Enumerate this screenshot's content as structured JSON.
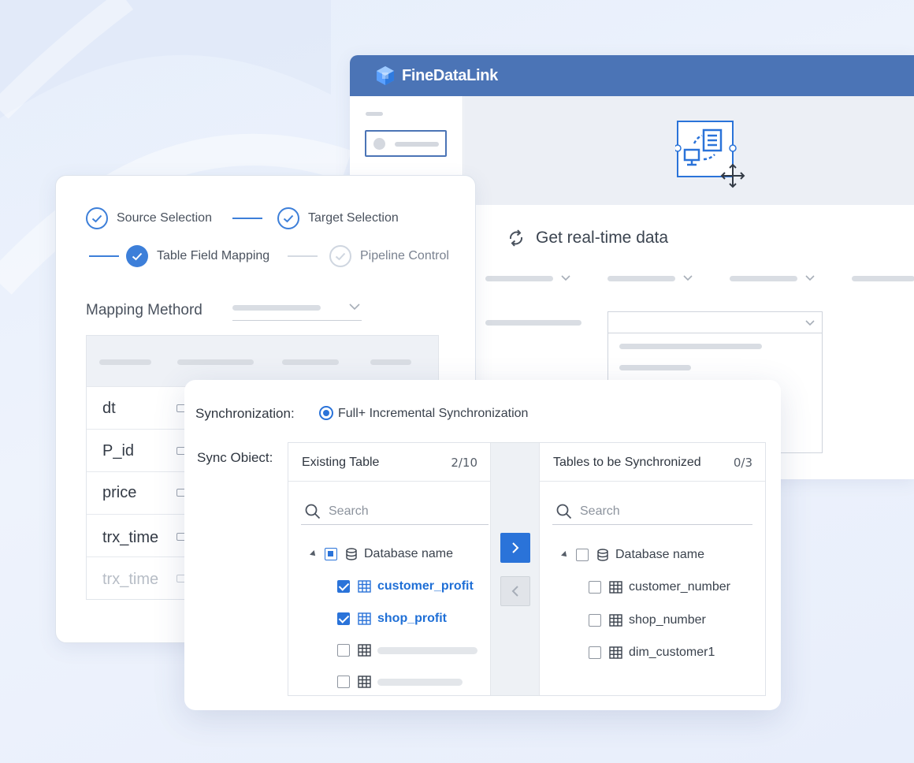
{
  "app": {
    "brand": "FineDataLink",
    "realtime_title": "Get real-time data"
  },
  "steps": [
    {
      "label": "Source Selection",
      "state": "done"
    },
    {
      "label": "Target Selection",
      "state": "done"
    },
    {
      "label": "Table Field Mapping",
      "state": "current"
    },
    {
      "label": "Pipeline Control",
      "state": "pending"
    }
  ],
  "mapping": {
    "label": "Mapping Methord",
    "rows": [
      "dt",
      "P_id",
      "price",
      "trx_time",
      "trx_time"
    ]
  },
  "sync": {
    "sync_label": "Synchronization:",
    "sync_option": "Full+ Incremental Synchronization",
    "object_label": "Sync Obiect:",
    "left": {
      "title": "Existing Table",
      "count": "2/10",
      "search_placeholder": "Search",
      "database": "Database name",
      "tables": [
        "customer_profit",
        "shop_profit"
      ]
    },
    "right": {
      "title": "Tables to be Synchronized",
      "count": "0/3",
      "search_placeholder": "Search",
      "database": "Database name",
      "tables": [
        "customer_number",
        "shop_number",
        "dim_customer1"
      ]
    }
  },
  "colors": {
    "brand_header": "#4b74b6",
    "accent": "#2a73d9",
    "step_blue": "#3d7fd9"
  }
}
